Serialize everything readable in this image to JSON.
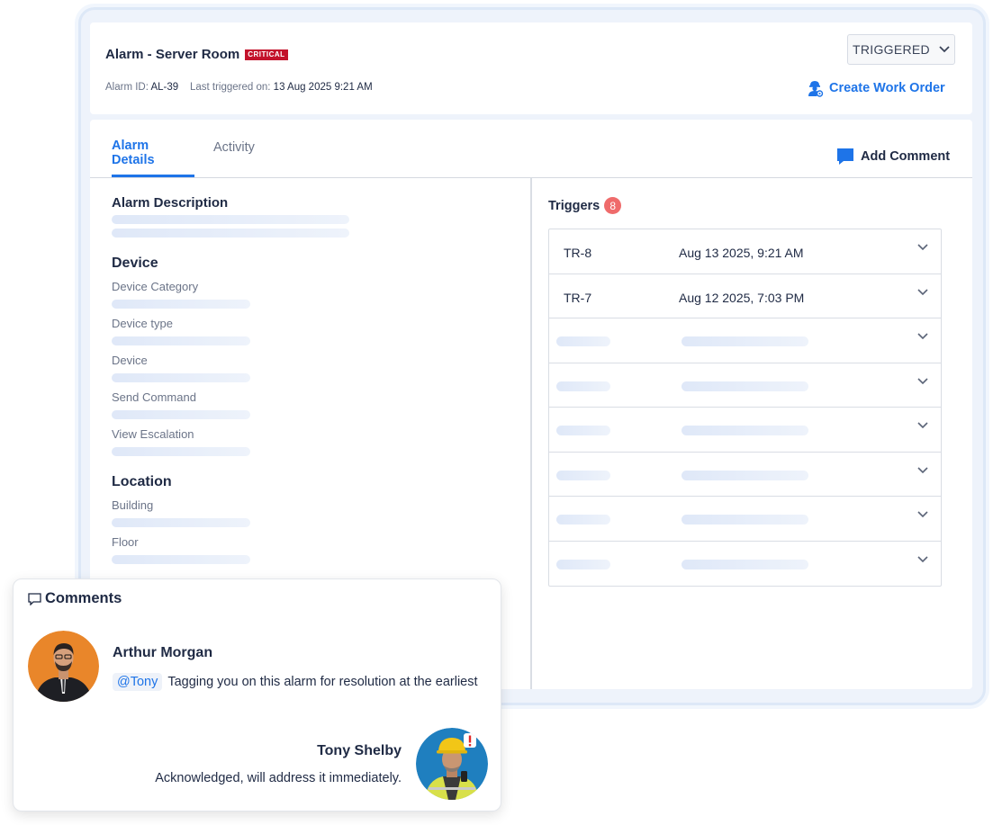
{
  "alarm": {
    "title": "Alarm - Server Room",
    "severity": "CRITICAL",
    "id_label": "Alarm ID:",
    "id_value": "AL-39",
    "last_label": "Last triggered on:",
    "last_value": "13 Aug 2025 9:21 AM",
    "status": "TRIGGERED",
    "create_work_order": "Create Work Order"
  },
  "tabs": [
    {
      "label": "Alarm Details",
      "active": true
    },
    {
      "label": "Activity",
      "active": false
    }
  ],
  "add_comment": "Add Comment",
  "details": {
    "description_title": "Alarm Description",
    "device_title": "Device",
    "device_fields": [
      "Device Category",
      "Device type",
      "Device",
      "Send Command",
      "View Escalation"
    ],
    "location_title": "Location",
    "location_fields": [
      "Building",
      "Floor"
    ]
  },
  "triggers": {
    "title": "Triggers",
    "count": "8",
    "rows": [
      {
        "id": "TR-8",
        "date": "Aug 13 2025, 9:21 AM"
      },
      {
        "id": "TR-7",
        "date": "Aug 12 2025, 7:03 PM"
      }
    ],
    "placeholder_rows": 6
  },
  "comments": {
    "title": "Comments",
    "items": [
      {
        "author": "Arthur Morgan",
        "mention": "@Tony",
        "text": "Tagging you on this alarm for resolution at the earliest"
      },
      {
        "author": "Tony Shelby",
        "text": "Acknowledged, will address it immediately."
      }
    ]
  },
  "colors": {
    "accent": "#1e74e8",
    "critical": "#c3122b",
    "badge": "#ef6b6b"
  }
}
